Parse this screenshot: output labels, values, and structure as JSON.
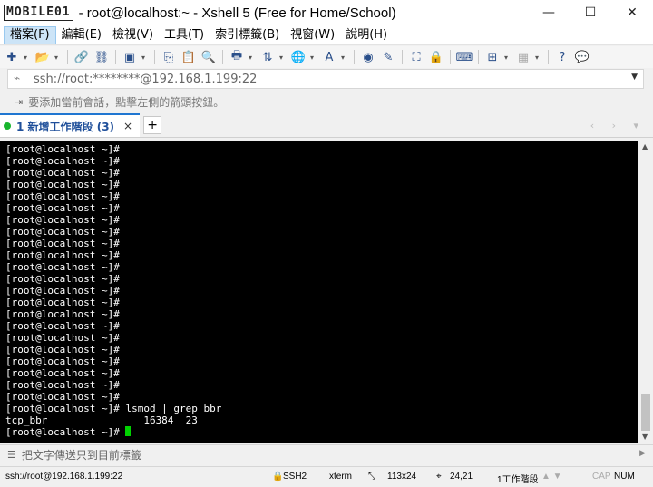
{
  "window": {
    "logo_text": "MOBILE01",
    "title": "- root@localhost:~ - Xshell 5 (Free for Home/School)",
    "minimize": "—",
    "maximize": "☐",
    "close": "✕"
  },
  "menu": [
    {
      "label": "檔案(F)"
    },
    {
      "label": "編輯(E)"
    },
    {
      "label": "檢視(V)"
    },
    {
      "label": "工具(T)"
    },
    {
      "label": "索引標籤(B)"
    },
    {
      "label": "視窗(W)"
    },
    {
      "label": "說明(H)"
    }
  ],
  "address": {
    "value": "ssh://root:********@192.168.1.199:22"
  },
  "hint": {
    "text": "要添加當前會話，點擊左側的箭頭按鈕。"
  },
  "tabs": [
    {
      "label": "1 新增工作階段 (3)",
      "close": "×"
    }
  ],
  "tab_add": "+",
  "tab_nav": "‹ › ▾",
  "terminal": {
    "lines": [
      "[root@localhost ~]#",
      "[root@localhost ~]#",
      "[root@localhost ~]#",
      "[root@localhost ~]#",
      "[root@localhost ~]#",
      "[root@localhost ~]#",
      "[root@localhost ~]#",
      "[root@localhost ~]#",
      "[root@localhost ~]#",
      "[root@localhost ~]#",
      "[root@localhost ~]#",
      "[root@localhost ~]#",
      "[root@localhost ~]#",
      "[root@localhost ~]#",
      "[root@localhost ~]#",
      "[root@localhost ~]#",
      "[root@localhost ~]#",
      "[root@localhost ~]#",
      "[root@localhost ~]#",
      "[root@localhost ~]#",
      "[root@localhost ~]#",
      "[root@localhost ~]#",
      "[root@localhost ~]# lsmod | grep bbr",
      "tcp_bbr                16384  23",
      "[root@localhost ~]# "
    ]
  },
  "compose": {
    "text": "把文字傳送只到目前標籤"
  },
  "status": {
    "connection": "ssh://root@192.168.1.199:22",
    "protocol": "SSH2",
    "terminal_type": "xterm",
    "size": "113x24",
    "cursor_pos": "24,21",
    "sessions": "1工作階段",
    "caps": "CAP",
    "num": "NUM"
  }
}
